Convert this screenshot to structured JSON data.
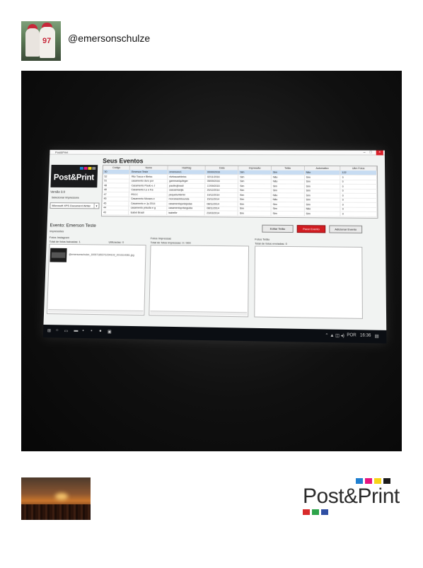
{
  "post": {
    "username": "@emersonschulze",
    "avatar_jersey_number": "97"
  },
  "app": {
    "window_title": "Post&Print",
    "window_controls": [
      "–",
      "□",
      "×"
    ],
    "logo_text": "Post&Print",
    "version": "Versão 3.0",
    "printer_label": "Selecionar Impressora",
    "printer_value": "Microsoft XPS Document Writer",
    "events_title": "Seus Eventos",
    "table": {
      "headers": [
        "Código",
        "Nome",
        "Hashtag",
        "Data",
        "Impressão",
        "Tetão",
        "Automatico",
        "Ultm Fotos"
      ],
      "rows": [
        [
          "50",
          "Emerson Teste",
          "emersonc1",
          "00/00/2016",
          "Sim",
          "Sim",
          "Não",
          "122"
        ],
        [
          "52",
          "Ritz Tosca e Bleiss",
          "ritzfoscaebleiss",
          "02/11/2016",
          "Sim",
          "Não",
          "Sim",
          "3"
        ],
        [
          "51",
          "casamento duro por",
          "garmeaniqufeger",
          "05/09/2016",
          "Sim",
          "Não",
          "Sim",
          "0"
        ],
        [
          "48",
          "Casamento Paulo e J",
          "paulinojbrasil",
          "17/09/2015",
          "Sim",
          "Sim",
          "Sim",
          "0"
        ],
        [
          "48",
          "Casamento Lu e Ka",
          "casoamianjia",
          "20/12/2014",
          "Sim",
          "Sim",
          "Sim",
          "0"
        ],
        [
          "47",
          "PECC",
          "pequetumbmin",
          "19/12/2014",
          "Sim",
          "Não",
          "Sim",
          "0"
        ],
        [
          "46",
          "Casamento Moraes e",
          "moroswsinbounda",
          "15/11/2014",
          "Sim",
          "Não",
          "Sim",
          "0"
        ],
        [
          "45",
          "Casamento e Jp 2014",
          "casamentojonlejsdas",
          "08/11/2014",
          "Sim",
          "Sim",
          "Sim",
          "0"
        ],
        [
          "44",
          "casamento priscila e g",
          "casamentopriseguida",
          "08/11/2014",
          "Sim",
          "Sim",
          "Não",
          "0"
        ],
        [
          "43",
          "Isabel Brasil",
          "isabelbr",
          "23/03/2014",
          "Sim",
          "Sim",
          "Sim",
          "0"
        ]
      ]
    },
    "buttons": {
      "edit": "Editar Tetão",
      "stop": "Parar Evento",
      "add": "Adicionar Evento"
    },
    "event": {
      "name": "Evento: Emerson Teste",
      "sub": "Impressões",
      "photos_label": "Fotos Instagram",
      "total_downloaded": "Total de fotos baixadas: 1",
      "used": "Utilizadas: 0",
      "thumb_file": "@emersonschulze_1005718537G294103_2016114361.jpg",
      "prints_label": "Fotos Impressas",
      "total_printed": "Total de fotos impressas: 0 / 900",
      "tetao_label": "Fotos Tetão",
      "total_tetao": "Total de fotos enviadas: 0"
    },
    "taskbar": {
      "lang": "POR",
      "time": "16:36"
    }
  },
  "footer": {
    "brand_text": "Post&Print",
    "brand_colors": [
      "#1f7fd0",
      "#e6157f",
      "#f7d417",
      "#1b1b1b",
      "#d82a2a",
      "#2ea44a",
      "#2f4fa3"
    ]
  }
}
